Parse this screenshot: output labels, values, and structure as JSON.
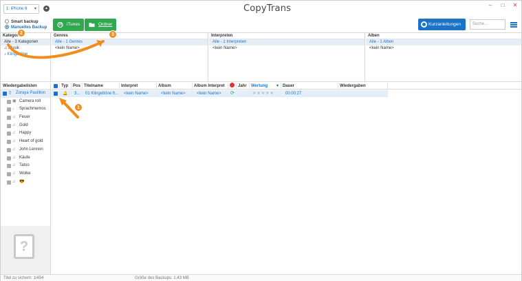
{
  "titlebar": {
    "device": "1: iPhone 6",
    "logo": "CopyTrans",
    "controls": {
      "min": "–",
      "max": "□",
      "close": "✕"
    }
  },
  "toolbar": {
    "smart_backup": "Smart backup",
    "manual_backup": "Manuelles Backup",
    "itunes_label": "iTunes",
    "ordner_label": "Ordner",
    "quick_guide": "Kurzanleitungen",
    "search_placeholder": "Suche..."
  },
  "browser": {
    "kategorien": {
      "header": "Kategorien",
      "items": [
        "Alle - 3 Kategorien",
        "Musik",
        "Klingeltöne"
      ]
    },
    "genres": {
      "header": "Genres",
      "items": [
        "Alle - 1 Genres",
        "<kein Name>"
      ]
    },
    "interpreten": {
      "header": "Interpreten",
      "items": [
        "Alle - 1 Interpreten",
        "<kein Name>"
      ]
    },
    "alben": {
      "header": "Alben",
      "items": [
        "Alle - 1 Alben",
        "<kein Name>"
      ]
    }
  },
  "playlists": {
    "header": "Wiedergabelisten",
    "device": "Zoraya Paulilion",
    "items": [
      "Camera roll",
      "Sprachmemos",
      "Feuer",
      "Gold",
      "Happy",
      "Heart of gold",
      "John Lennon",
      "Käufe",
      "Tatoo",
      "Wolke",
      "😎"
    ]
  },
  "table": {
    "columns": [
      "Typ",
      "Pos",
      "Titelname",
      "Interpret",
      "Album",
      "Album Interpret",
      "Jahr",
      "Wertung",
      "Dauer",
      "Wiedergaben"
    ],
    "rows": [
      {
        "pos": "3...",
        "title": "01 Klingeltöne fr...",
        "artist": "<kein Name>",
        "album": "<kein Name>",
        "album_artist": "<kein Name>",
        "rating": "★★★★★",
        "duration": "00:00:27"
      }
    ]
  },
  "status": {
    "titles": "Titel zu sichern: 1/454",
    "backup_size": "Größe des Backups: 1.43 MB"
  },
  "callouts": [
    "1",
    "2",
    "3"
  ],
  "colors": {
    "green": "#2fa84f",
    "blue": "#1a73c9",
    "orange": "#f28c1a"
  }
}
